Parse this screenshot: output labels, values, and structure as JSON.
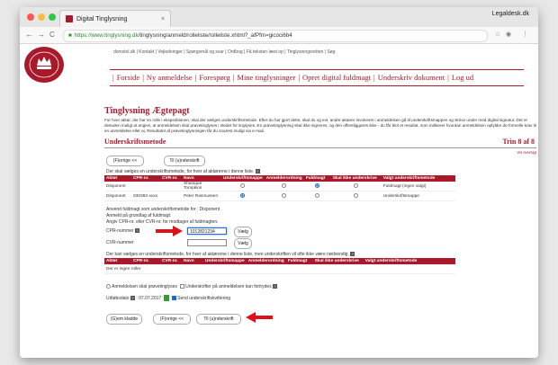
{
  "browser": {
    "tab_title": "Digital Tinglysning",
    "tab_close": "×",
    "profile": "Legaldesk.dk",
    "url_domain": "https://www.tinglysning.dk",
    "url_path": "/tinglysning/anmeld/rolleliste/rolleliste.xhtml?_afPfm=gicoci6b4",
    "back": "←",
    "forward": "→",
    "reload": "C",
    "star": "☆",
    "menu": "⋮"
  },
  "top_links": [
    "domstol.dk",
    "Kontakt",
    "Vejledninger",
    "Spørgsmål og svar",
    "Ordbog",
    "Få teksten læst op",
    "Tinglysningsretten",
    "Søg"
  ],
  "nav": [
    "Forside",
    "Ny anmeldelse",
    "Forespørg",
    "Mine tinglysninger",
    "Opret digital fuldmagt",
    "Underskriv dokument",
    "Log ud"
  ],
  "page": {
    "title": "Tinglysning Ægtepagt",
    "intro": "For hver aktør, der har en rolle i ekspeditionen, skal der vælges underskriftsmetode. Efter du har gjort dette, skal du og evt. andre aktører involveret i anmeldelsen gå til underskriftsmappen og skrive under med digital signatur. Det er desuden muligt at angive, at anmeldelsen skal prøvetinglyses i stedet for tinglyses. En prøvetinglysning skal ikke signeres, og den offentliggøres ikke - du får blot et resultat, som indikerer hvordan anmeldelsen opfylder de formelle krav til en anmeldelse eller ej. Resultatet af prøvetinglysningen får du snarest muligt via e-mail.",
    "section_title": "Underskriftsmetode",
    "step": "Trin 8 af 8",
    "vis_oversigt": "Vis oversigt"
  },
  "buttons": {
    "prev": "(F)orrige <<",
    "next": "Til (u)nderskrift",
    "save": "(G)em kladde",
    "choose": "Vælg"
  },
  "table1": {
    "instruction": "Der skal vælges en underskriftsmetode, for hver af aktørerne i denne liste.",
    "headers": [
      "Aktør",
      "CPR-nr.",
      "CVR-nr.",
      "Navn",
      "Underskriftsmappe",
      "Anmelderordning",
      "Fuldmagt",
      "Skal ikke underskrive",
      "Valgt underskriftsmetode"
    ],
    "rows": [
      {
        "aktor": "Disponent",
        "cpr": "",
        "cvr": "",
        "navn": "Shanique Tompkins",
        "choice": "Fuldmagt",
        "selected": "Fuldmagt (ingen valgt)"
      },
      {
        "aktor": "Disponent",
        "cpr": "030382-xxxx",
        "cvr": "",
        "navn": "Peter Rasmussen",
        "choice": "Underskriftsmappe",
        "selected": "Underskriftsmappe"
      }
    ]
  },
  "fuldmagt": {
    "line1": "Anvend fuldmagt som underskriftsmetode for : Disponent",
    "line2": "Anmeld på grundlag af fuldmagt.",
    "line3": "Angiv CPR-nr. eller CVR-nr. for modtager af fuldmagten.",
    "cpr_label": "CPR-nummer",
    "cpr_value": "1012821234",
    "cvr_label": "CVR-nummer",
    "cvr_value": ""
  },
  "table2": {
    "instruction": "Der kan vælges en underskriftsmetode, for hver af aktørerne i denne liste, men underskriften vil ofte ikke være nødvendig.",
    "headers": [
      "Aktør",
      "CPR-nr.",
      "CVR-nr.",
      "Navn",
      "Underskriftsmappe",
      "Anmelderordning",
      "Fuldmagt",
      "Skal ikke underskrive",
      "Valgt underskriftsmetode"
    ],
    "empty": "Der er ingen roller"
  },
  "options": {
    "proeve": "Anmeldelsen skal prøvetinglyses",
    "fortrydes": "Underskrifter på anmeldelsen kan fortrydes",
    "udloeb_label": "Udløbsdato",
    "udloeb_value": "07.07.2017",
    "send_kvittering": "Send underskriftskvittering"
  },
  "colors": {
    "brand": "#a9192a",
    "arrow": "#e0101a",
    "focus": "#1a6ad0"
  }
}
